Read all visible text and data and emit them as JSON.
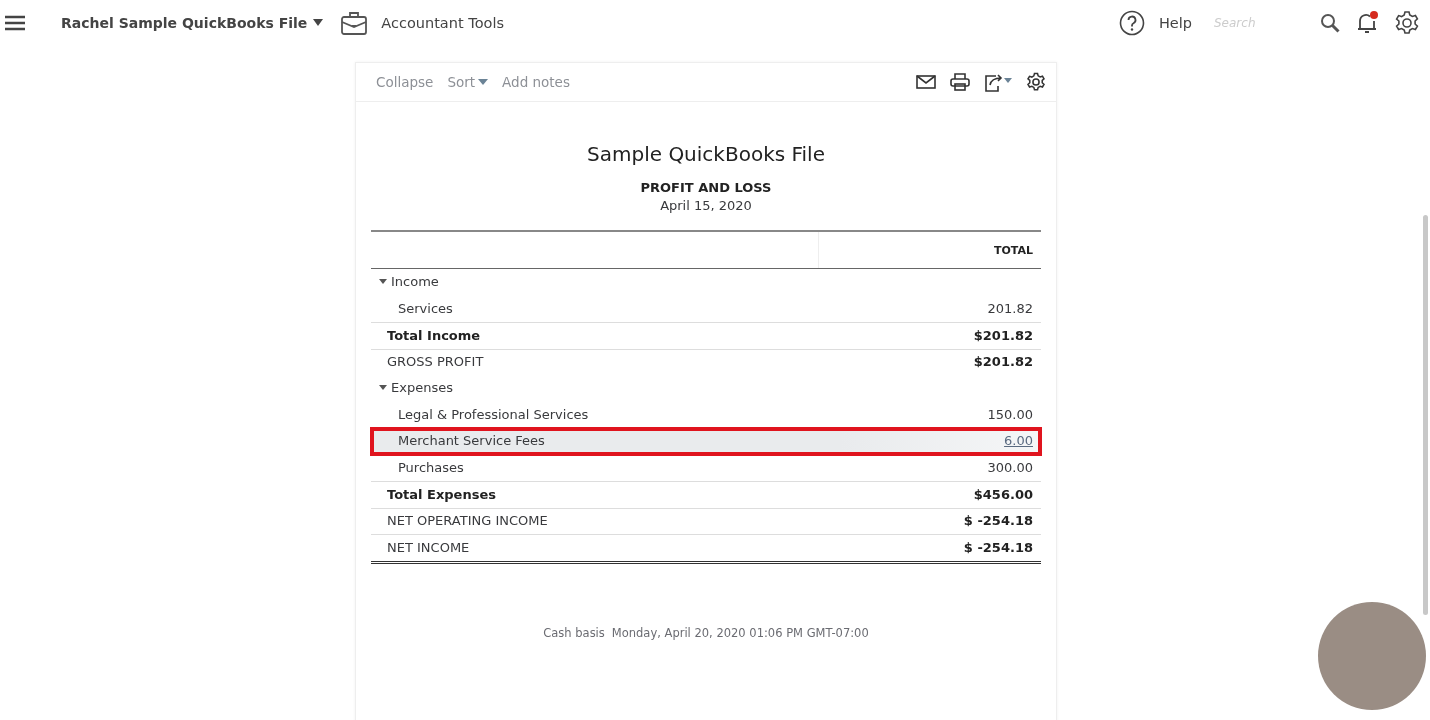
{
  "top_bar": {
    "company": "Rachel Sample QuickBooks File",
    "accountant_tools": "Accountant Tools",
    "help": "Help",
    "search": {
      "placeholder": "Search"
    },
    "notification_badge": true
  },
  "toolbar": {
    "links": [
      {
        "label": "Collapse",
        "kind": "plain"
      },
      {
        "label": "Sort",
        "kind": "dropdown"
      },
      {
        "label": "Add notes",
        "kind": "plain"
      }
    ]
  },
  "report": {
    "company": "Sample QuickBooks File",
    "title": "PROFIT AND LOSS",
    "date": "April 15, 2020",
    "column": "TOTAL",
    "rows": [
      {
        "kind": "section",
        "label": "Income",
        "expanded": true,
        "amount": ""
      },
      {
        "kind": "item",
        "label": "Services",
        "amount": "201.82",
        "highlighted": false
      },
      {
        "kind": "total",
        "label": "Total Income",
        "amount": "$201.82"
      },
      {
        "kind": "summary",
        "label": "GROSS PROFIT",
        "amount": "$201.82"
      },
      {
        "kind": "section",
        "label": "Expenses",
        "expanded": true,
        "amount": ""
      },
      {
        "kind": "item",
        "label": "Legal & Professional Services",
        "amount": "150.00",
        "highlighted": false
      },
      {
        "kind": "item",
        "label": "Merchant Service Fees",
        "amount": "6.00",
        "highlighted": true
      },
      {
        "kind": "item",
        "label": "Purchases",
        "amount": "300.00",
        "highlighted": false
      },
      {
        "kind": "total",
        "label": "Total Expenses",
        "amount": "$456.00"
      },
      {
        "kind": "summary",
        "label": "NET OPERATING INCOME",
        "amount": "$ -254.18"
      },
      {
        "kind": "summary",
        "label": "NET INCOME",
        "amount": "$ -254.18"
      }
    ],
    "footer": {
      "basis": "Cash basis",
      "timestamp": "Monday, April 20, 2020  01:06 PM GMT-07:00"
    }
  }
}
